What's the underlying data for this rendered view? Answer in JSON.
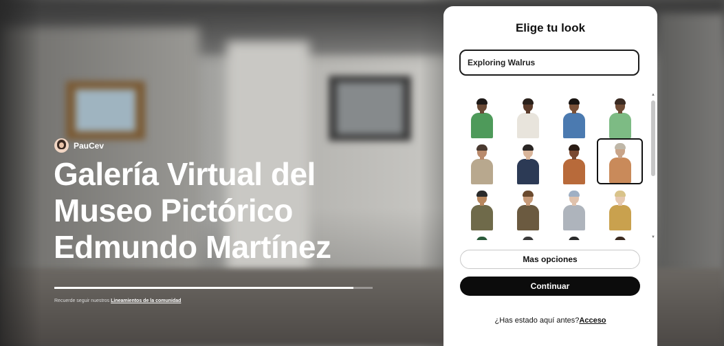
{
  "space": {
    "author_name": "PauCev",
    "title": "Galería Virtual del Museo Pictórico Edmundo Martínez",
    "loading_progress": 0.94,
    "community_prefix": "Recuerde seguir nuestros ",
    "community_link": "Lineamientos de la comunidad"
  },
  "panel": {
    "title": "Elige tu look",
    "name_value": "Exploring Walrus",
    "more_options_label": "Mas opciones",
    "continue_label": "Continuar",
    "been_here_text": "¿Has estado aquí antes?",
    "login_link": "Acceso"
  },
  "avatars": [
    {
      "id": "a1",
      "skin": "#6a4a36",
      "hair": "#1e1a18",
      "top": "#4e9a5a",
      "selected": false
    },
    {
      "id": "a2",
      "skin": "#5b3b2b",
      "hair": "#2a211c",
      "top": "#e8e4dc",
      "selected": false
    },
    {
      "id": "a3",
      "skin": "#7a5138",
      "hair": "#1a1512",
      "top": "#4b7ab0",
      "selected": false
    },
    {
      "id": "a4",
      "skin": "#6e4a34",
      "hair": "#3a2a22",
      "top": "#7dbb84",
      "selected": false
    },
    {
      "id": "a5",
      "skin": "#b98a6c",
      "hair": "#4a3a30",
      "top": "#b8a88e",
      "selected": false
    },
    {
      "id": "a6",
      "skin": "#d9b59a",
      "hair": "#2a2624",
      "top": "#2c3a55",
      "selected": false
    },
    {
      "id": "a7",
      "skin": "#7a4a32",
      "hair": "#2b1c14",
      "top": "#b86a3a",
      "selected": false
    },
    {
      "id": "a8",
      "skin": "#c9a488",
      "hair": "#bfb7a8",
      "top": "#c98a5a",
      "selected": true
    },
    {
      "id": "a9",
      "skin": "#b8875e",
      "hair": "#2a2a2a",
      "top": "#6f6a4a",
      "selected": false
    },
    {
      "id": "a10",
      "skin": "#c79a78",
      "hair": "#6b4a2e",
      "top": "#6b5a40",
      "selected": false
    },
    {
      "id": "a11",
      "skin": "#e0c2ac",
      "hair": "#9fb0c4",
      "top": "#aeb4bc",
      "selected": false
    },
    {
      "id": "a12",
      "skin": "#e6c9b1",
      "hair": "#d9c38a",
      "top": "#c9a14e",
      "selected": false
    },
    {
      "id": "a13",
      "skin": "#7a5a42",
      "hair": "#2a5a3a",
      "top": "#5a7a5a",
      "selected": false
    },
    {
      "id": "a14",
      "skin": "#c9a488",
      "hair": "#3a3a3a",
      "top": "#6a6a6a",
      "selected": false
    },
    {
      "id": "a15",
      "skin": "#e0c2ac",
      "hair": "#2a2a2a",
      "top": "#9a9a9a",
      "selected": false
    },
    {
      "id": "a16",
      "skin": "#c9a488",
      "hair": "#3a2a20",
      "top": "#8a7a6a",
      "selected": false
    }
  ]
}
